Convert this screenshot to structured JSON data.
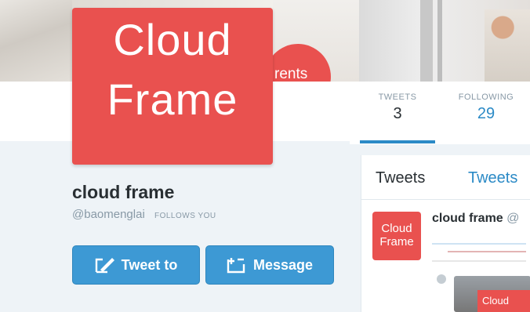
{
  "banner": {
    "visible_text": "rents"
  },
  "profile": {
    "logo_line1": "Cloud",
    "logo_line2": "Frame",
    "display_name": "cloud frame",
    "handle": "@baomenglai",
    "follows_badge": "FOLLOWS YOU",
    "tweet_to_label": "Tweet to",
    "message_label": "Message"
  },
  "stats": [
    {
      "label": "TWEETS",
      "value": "3"
    },
    {
      "label": "FOLLOWING",
      "value": "29"
    }
  ],
  "timeline": {
    "tabs": [
      "Tweets",
      "Tweets"
    ],
    "avatar_line1": "Cloud",
    "avatar_line2": "Frame",
    "author_name": "cloud frame",
    "author_at": "@",
    "thumb_text": "Cloud"
  },
  "colors": {
    "accent": "#3d99d4",
    "brand_red": "#e9514f",
    "link_blue": "#2b8ac6"
  },
  "icons": [
    "compose-icon",
    "message-icon"
  ]
}
